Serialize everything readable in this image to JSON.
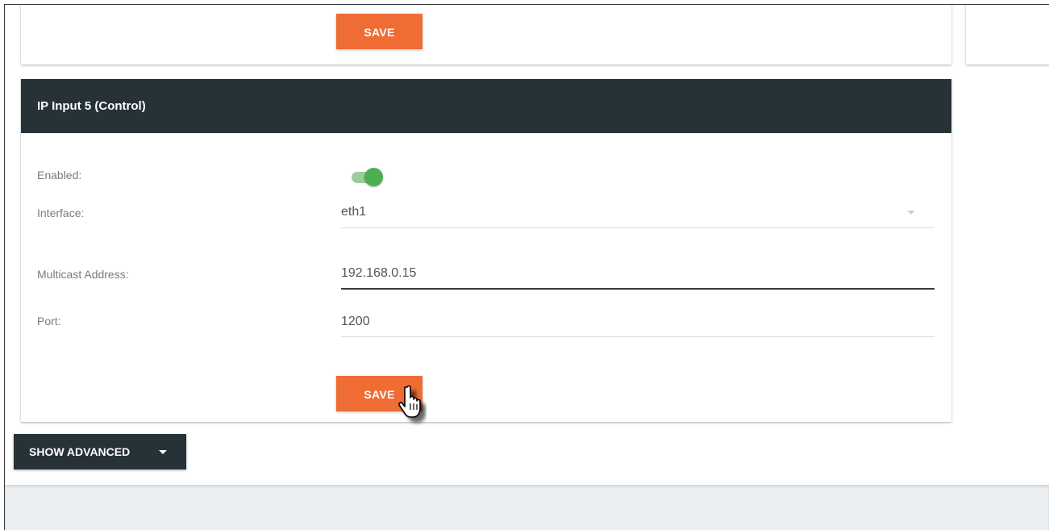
{
  "top_card": {
    "save_label": "SAVE"
  },
  "ip_input_card": {
    "title": "IP Input 5 (Control)",
    "enabled": {
      "label": "Enabled:",
      "value": true
    },
    "interface": {
      "label": "Interface:",
      "value": "eth1"
    },
    "multicast_address": {
      "label": "Multicast Address:",
      "value": "192.168.0.15"
    },
    "port": {
      "label": "Port:",
      "value": "1200"
    },
    "save_label": "SAVE"
  },
  "show_advanced_label": "SHOW ADVANCED",
  "colors": {
    "accent": "#ef6c35",
    "header": "#263238",
    "toggle_on": "#4caf50"
  },
  "icons": {
    "toggle": "toggle-switch-on",
    "dropdown": "chevron-down-icon",
    "cursor": "hand-pointer-icon"
  }
}
